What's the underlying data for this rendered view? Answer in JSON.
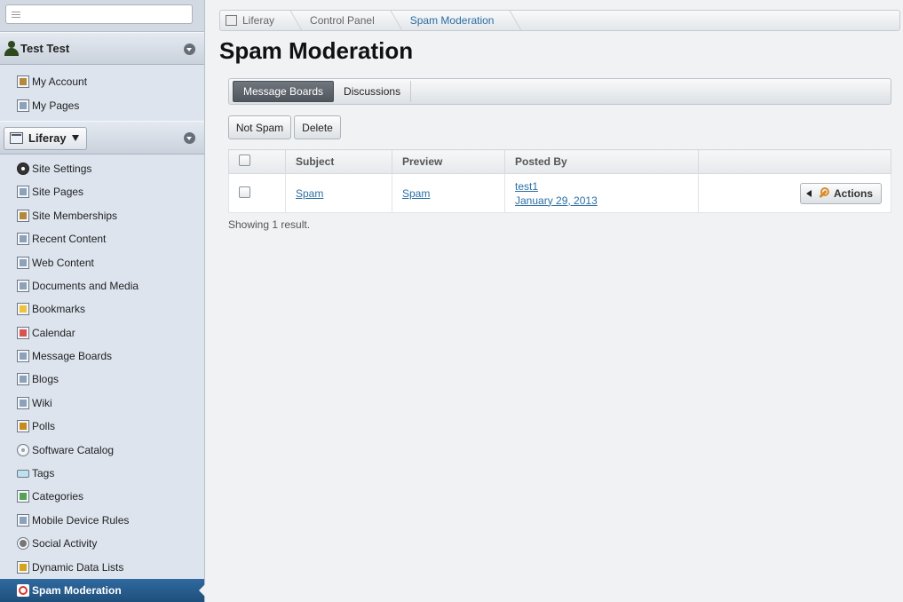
{
  "sidebar": {
    "search": {
      "placeholder": ""
    },
    "user": {
      "name": "Test Test"
    },
    "user_items": [
      {
        "label": "My Account",
        "icon": "account-icon"
      },
      {
        "label": "My Pages",
        "icon": "pages-icon"
      }
    ],
    "site": {
      "name": "Liferay"
    },
    "site_items": [
      {
        "label": "Site Settings",
        "icon": "gear-icon"
      },
      {
        "label": "Site Pages",
        "icon": "pages-icon"
      },
      {
        "label": "Site Memberships",
        "icon": "people-icon"
      },
      {
        "label": "Recent Content",
        "icon": "recent-content-icon"
      },
      {
        "label": "Web Content",
        "icon": "web-content-icon"
      },
      {
        "label": "Documents and Media",
        "icon": "documents-icon"
      },
      {
        "label": "Bookmarks",
        "icon": "bookmarks-icon"
      },
      {
        "label": "Calendar",
        "icon": "calendar-icon"
      },
      {
        "label": "Message Boards",
        "icon": "message-boards-icon"
      },
      {
        "label": "Blogs",
        "icon": "blogs-icon"
      },
      {
        "label": "Wiki",
        "icon": "wiki-icon"
      },
      {
        "label": "Polls",
        "icon": "polls-icon"
      },
      {
        "label": "Software Catalog",
        "icon": "software-catalog-icon"
      },
      {
        "label": "Tags",
        "icon": "tag-icon"
      },
      {
        "label": "Categories",
        "icon": "categories-icon"
      },
      {
        "label": "Mobile Device Rules",
        "icon": "mobile-device-icon"
      },
      {
        "label": "Social Activity",
        "icon": "social-activity-icon"
      },
      {
        "label": "Dynamic Data Lists",
        "icon": "dynamic-data-lists-icon"
      },
      {
        "label": "Spam Moderation",
        "icon": "spam-icon"
      }
    ]
  },
  "breadcrumb": [
    "Liferay",
    "Control Panel",
    "Spam Moderation"
  ],
  "page": {
    "title": "Spam Moderation"
  },
  "tabs": [
    "Message Boards",
    "Discussions"
  ],
  "toolbar": {
    "not_spam": "Not Spam",
    "delete": "Delete"
  },
  "table": {
    "headers": [
      "",
      "Subject",
      "Preview",
      "Posted By",
      ""
    ],
    "rows": [
      {
        "subject": "Spam",
        "preview": "Spam",
        "posted_by": "test1",
        "date": "January 29, 2013",
        "actions": "Actions"
      }
    ]
  },
  "results_text": "Showing 1 result.",
  "colors": {
    "active_nav": "#2f6aa0",
    "link": "#2b6ea4",
    "sidebar_bg": "#dde4ee"
  }
}
